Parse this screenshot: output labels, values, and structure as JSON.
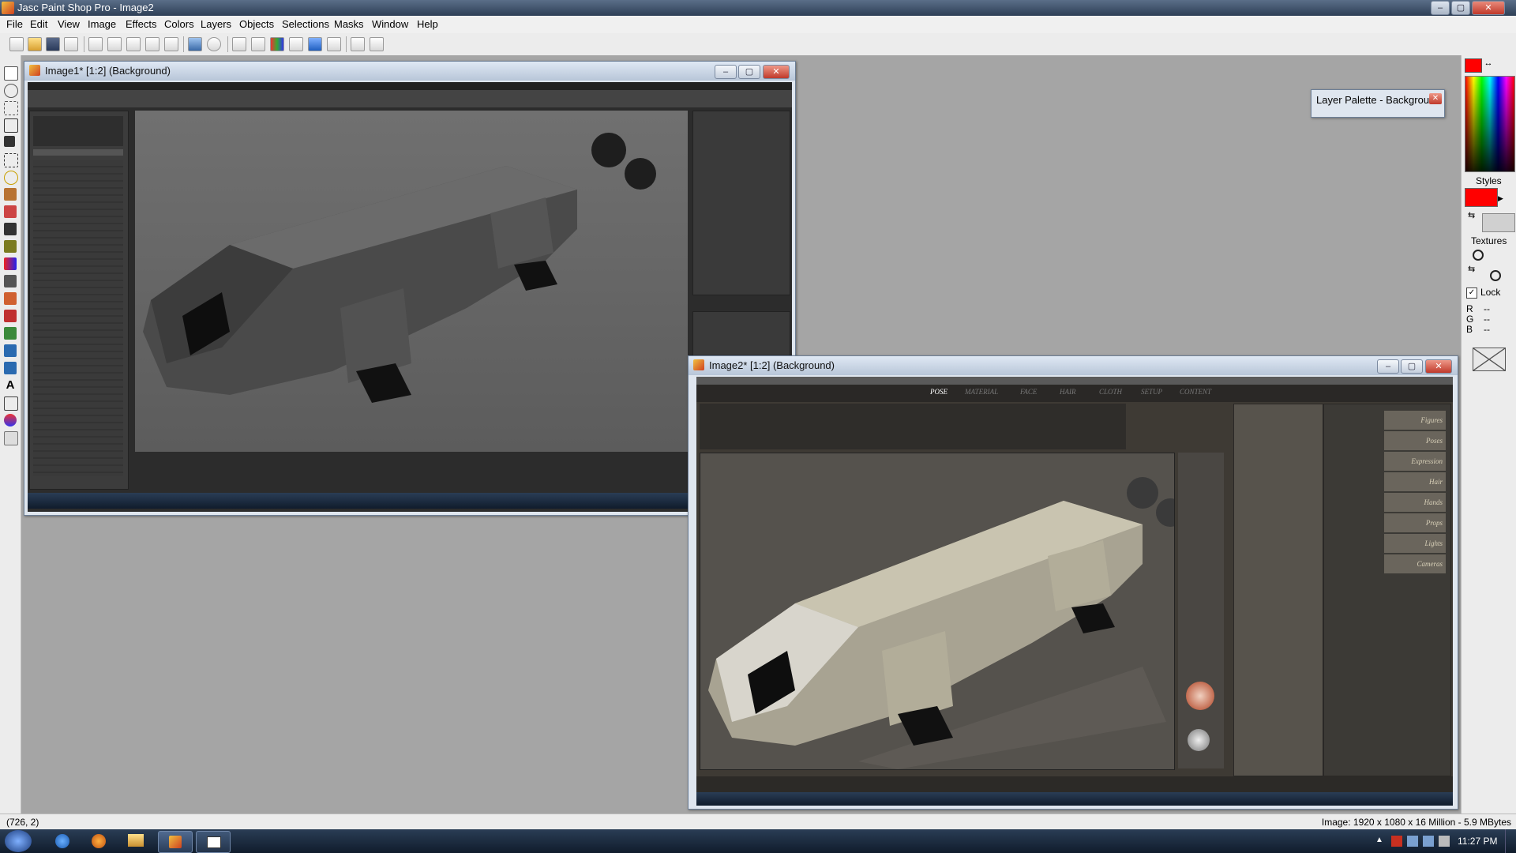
{
  "app": {
    "title": "Jasc Paint Shop Pro - Image2",
    "window_controls": [
      "–",
      "▢",
      "✕"
    ]
  },
  "menu": [
    "File",
    "Edit",
    "View",
    "Image",
    "Effects",
    "Colors",
    "Layers",
    "Objects",
    "Selections",
    "Masks",
    "Window",
    "Help"
  ],
  "windows": {
    "image1": {
      "title": "Image1* [1:2] (Background)"
    },
    "image2": {
      "title": "Image2* [1:2] (Background)"
    }
  },
  "daz_tabs": [
    "POSE",
    "MATERIAL",
    "FACE",
    "HAIR",
    "CLOTH",
    "SETUP",
    "CONTENT"
  ],
  "daz_categories": [
    "Figures",
    "Poses",
    "Expression",
    "Hair",
    "Hands",
    "Props",
    "Lights",
    "Cameras"
  ],
  "layer_palette": {
    "title": "Layer Palette - Backgrou..."
  },
  "right_panel": {
    "styles_label": "Styles",
    "textures_label": "Textures",
    "lock_label": "Lock",
    "lock_checked": true,
    "rgb_labels": [
      "R",
      "G",
      "B"
    ],
    "rgb_values": [
      "--",
      "--",
      "--"
    ],
    "fg_color": "#ff0000",
    "style_color": "#ff0000"
  },
  "status": {
    "coords": "(726, 2)",
    "image_info": "Image: 1920 x 1080 x 16 Million - 5.9 MBytes"
  },
  "taskbar": {
    "time": "11:27 PM"
  }
}
